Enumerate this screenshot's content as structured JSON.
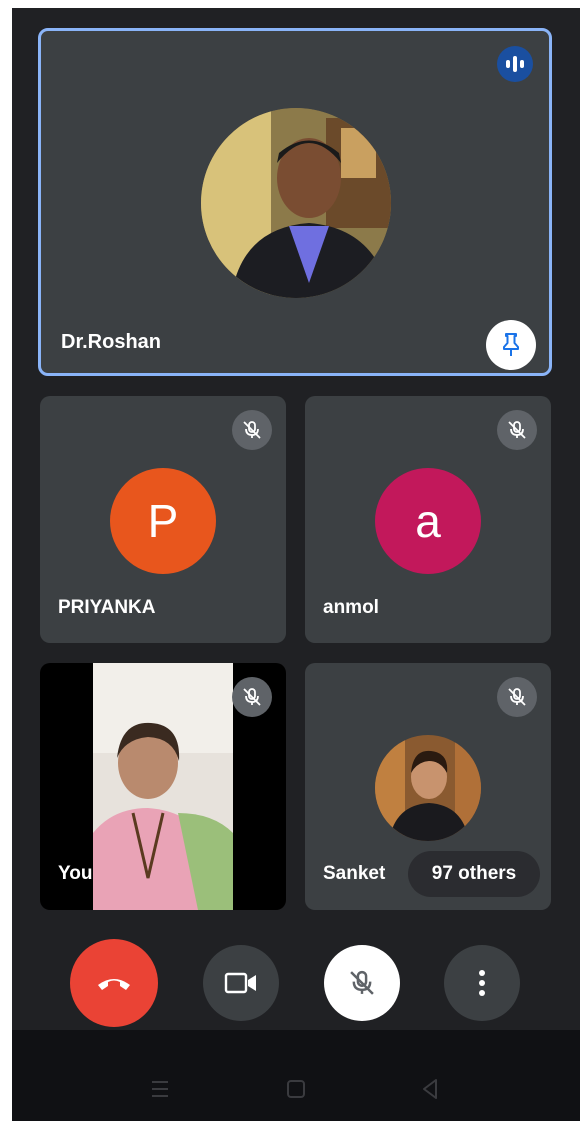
{
  "main_speaker": {
    "name": "Dr.Roshan"
  },
  "participants": [
    {
      "name": "PRIYANKA",
      "initial": "P",
      "color": "#e8561d"
    },
    {
      "name": "anmol",
      "initial": "a",
      "color": "#c2185b"
    },
    {
      "name": "You"
    },
    {
      "name": "Sanket"
    }
  ],
  "others_chip": {
    "label": "97 others"
  },
  "colors": {
    "end_call": "#ea4335",
    "active_border": "#8ab4f8",
    "tile_bg": "#3c4043",
    "speaking_indicator": "#1a4fa0"
  },
  "icons": {
    "speaking": "audio-bars-icon",
    "pin": "pin-icon",
    "muted": "mic-off-icon",
    "end_call": "phone-hangup-icon",
    "camera": "video-camera-icon",
    "mic": "mic-off-icon",
    "more": "more-vert-icon"
  }
}
